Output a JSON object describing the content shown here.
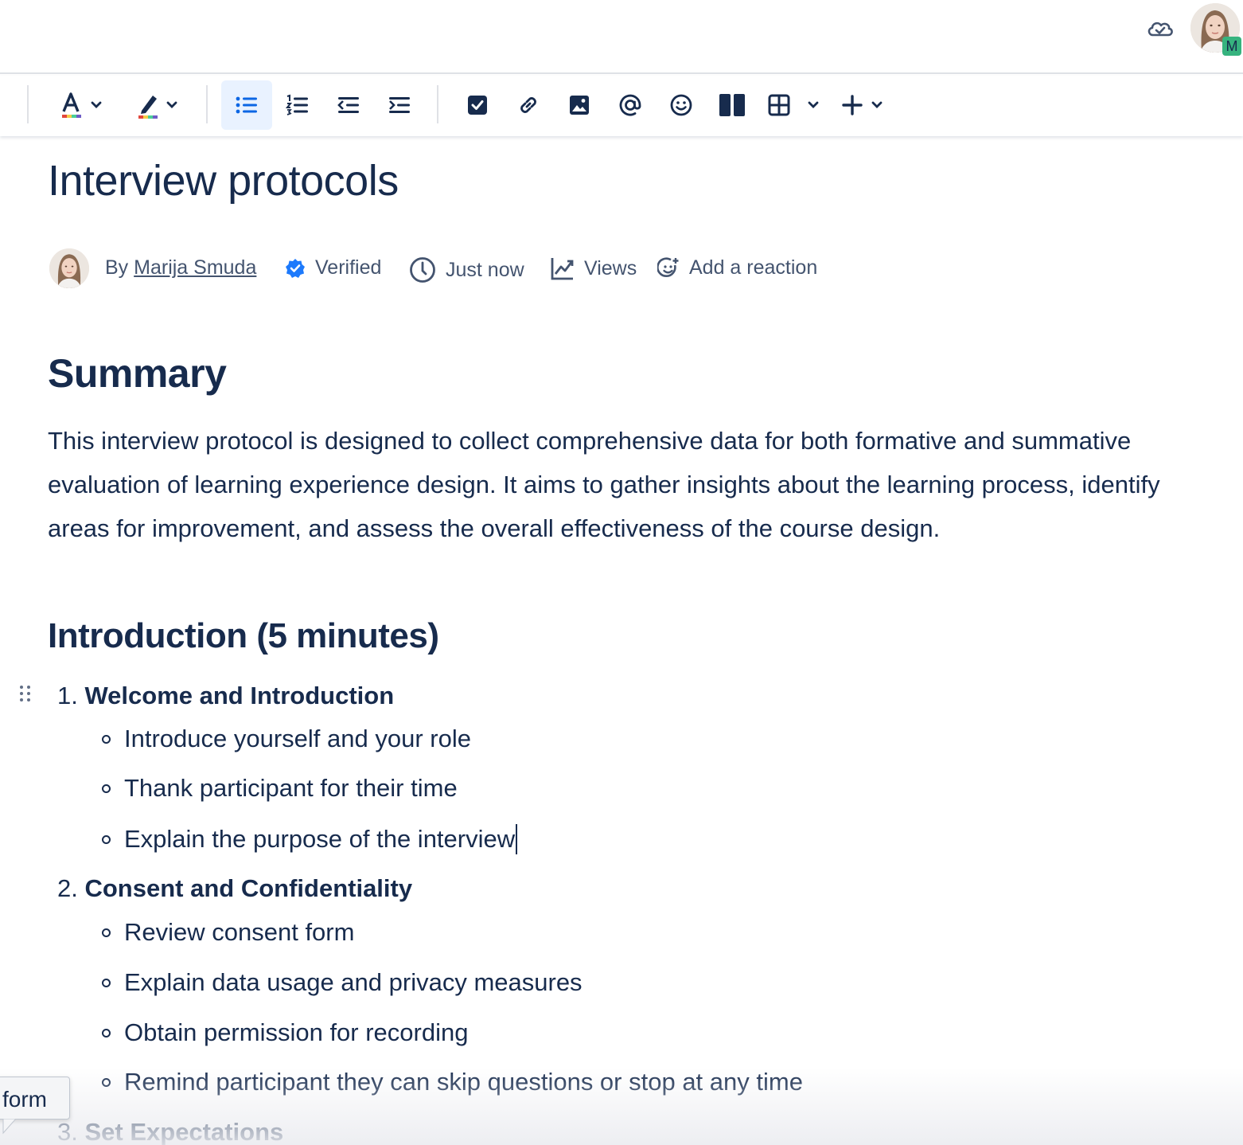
{
  "topbar": {
    "avatar_badge": "M",
    "icons": [
      "cloud-sync-icon",
      "user-avatar"
    ]
  },
  "toolbar": {
    "buttons": [
      "text-color-icon",
      "highlight-icon",
      "bullet-list-icon",
      "numbered-list-icon",
      "outdent-icon",
      "indent-icon",
      "action-item-icon",
      "link-icon",
      "image-icon",
      "mention-icon",
      "emoji-icon",
      "layouts-icon",
      "table-icon",
      "insert-plus-icon"
    ],
    "active": "bullet-list-icon"
  },
  "page": {
    "title": "Interview protocols",
    "byline": {
      "by": "By",
      "author": "Marija Smuda",
      "verified": "Verified",
      "time": "Just now",
      "views": "Views",
      "reaction": "Add a reaction"
    },
    "summary_heading": "Summary",
    "summary_text": "This interview protocol is designed to collect comprehensive data for both formative and summative evaluation of learning experience design. It aims to gather insights about the learning process, identify areas for improvement, and assess the overall effectiveness of the course design.",
    "intro_heading": "Introduction (5 minutes)",
    "steps": [
      {
        "num": "1.",
        "label": "Welcome and Introduction",
        "items": [
          "Introduce yourself and your role",
          "Thank participant for their time",
          "Explain the purpose of the interview"
        ]
      },
      {
        "num": "2.",
        "label": "Consent and Confidentiality",
        "items": [
          "Review consent form",
          "Explain data usage and privacy measures",
          "Obtain permission for recording",
          "Remind participant they can skip questions or stop at any time"
        ]
      },
      {
        "num": "3.",
        "label": "Set Expectations",
        "items": []
      }
    ]
  },
  "tooltip": {
    "text": "form"
  },
  "colors": {
    "text": "#172b4d",
    "subtle": "#44546f",
    "accent": "#0c66e4",
    "active_bg": "#e9f2ff",
    "badge": "#36b37e"
  }
}
